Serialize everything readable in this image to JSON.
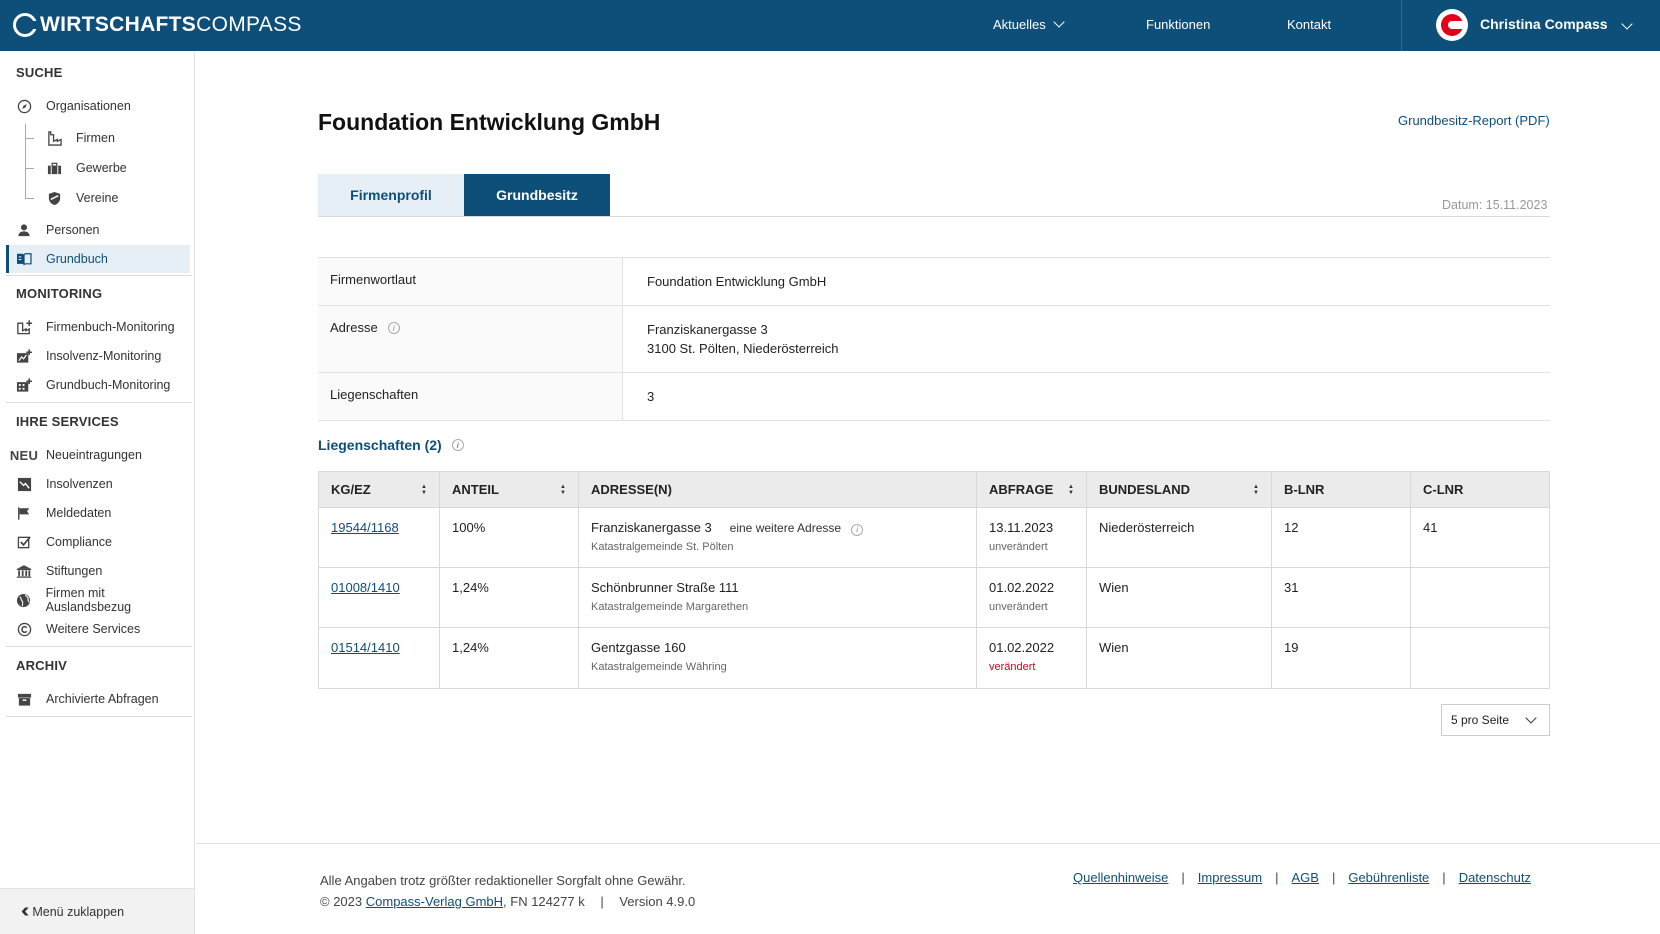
{
  "header": {
    "logo_bold": "WIRTSCHAFTS",
    "logo_light": "COMPASS",
    "nav": [
      {
        "label": "Aktuelles"
      },
      {
        "label": "Funktionen"
      },
      {
        "label": "Kontakt"
      }
    ],
    "user_name": "Christina Compass"
  },
  "sidebar": {
    "sections": {
      "suche": "SUCHE",
      "monitoring": "MONITORING",
      "services": "IHRE SERVICES",
      "archiv": "ARCHIV"
    },
    "items": {
      "organisationen": "Organisationen",
      "firmen": "Firmen",
      "gewerbe": "Gewerbe",
      "vereine": "Vereine",
      "personen": "Personen",
      "grundbuch": "Grundbuch",
      "firmenbuch_monitoring": "Firmenbuch-Monitoring",
      "insolvenz_monitoring": "Insolvenz-Monitoring",
      "grundbuch_monitoring": "Grundbuch-Monitoring",
      "neueintragungen": "Neueintragungen",
      "neu_badge": "NEU",
      "insolvenzen": "Insolvenzen",
      "meldedaten": "Meldedaten",
      "compliance": "Compliance",
      "stiftungen": "Stiftungen",
      "auslandsbezug": "Firmen mit Auslandsbezug",
      "weitere_services": "Weitere Services",
      "archivierte_abfragen": "Archivierte Abfragen"
    },
    "collapse_label": "Menü zuklappen"
  },
  "main": {
    "title": "Foundation Entwicklung GmbH",
    "report_link": "Grundbesitz-Report (PDF)",
    "tabs": [
      {
        "label": "Firmenprofil",
        "active": false
      },
      {
        "label": "Grundbesitz",
        "active": true
      }
    ],
    "datum": "Datum: 15.11.2023",
    "info": {
      "firmenwortlaut_label": "Firmenwortlaut",
      "firmenwortlaut_value": "Foundation Entwicklung GmbH",
      "adresse_label": "Adresse",
      "adresse_line1": "Franziskanergasse 3",
      "adresse_line2": "3100 St. Pölten, Niederösterreich",
      "liegenschaften_label": "Liegenschaften",
      "liegenschaften_value": "3"
    },
    "liegenschaften_heading": "Liegenschaften (2)",
    "table": {
      "headers": [
        "KG/EZ",
        "ANTEIL",
        "ADRESSE(N)",
        "ABFRAGE",
        "BUNDESLAND",
        "B-LNR",
        "C-LNR"
      ],
      "rows": [
        {
          "kgez": "19544/1168",
          "anteil": "100%",
          "adresse": "Franziskanergasse 3",
          "more": "eine weitere Adresse",
          "kg": "Katastralgemeinde St. Pölten",
          "abfrage": "13.11.2023",
          "status": "unverändert",
          "bundesland": "Niederösterreich",
          "blnr": "12",
          "clnr": "41"
        },
        {
          "kgez": "01008/1410",
          "anteil": "1,24%",
          "adresse": "Schönbrunner Straße 111",
          "more": "",
          "kg": "Katastralgemeinde Margarethen",
          "abfrage": "01.02.2022",
          "status": "unverändert",
          "bundesland": "Wien",
          "blnr": "31",
          "clnr": ""
        },
        {
          "kgez": "01514/1410",
          "anteil": "1,24%",
          "adresse": "Gentzgasse 160",
          "more": "",
          "kg": "Katastralgemeinde Währing",
          "abfrage": "01.02.2022",
          "status": "verändert",
          "bundesland": "Wien",
          "blnr": "19",
          "clnr": ""
        }
      ]
    },
    "per_page": "5 pro Seite"
  },
  "footer": {
    "disclaimer": "Alle Angaben trotz größter redaktioneller Sorgfalt ohne Gewähr.",
    "copyright_prefix": "© 2023",
    "company_link": "Compass-Verlag GmbH",
    "copyright_suffix": ", FN 124277 k",
    "version": "Version 4.9.0",
    "separator": "|",
    "links": [
      "Quellenhinweise",
      "Impressum",
      "AGB",
      "Gebührenliste",
      "Datenschutz"
    ]
  },
  "colors": {
    "brand": "#0e4f7a",
    "accent_red": "#e2001a",
    "status_changed": "#d0021b"
  }
}
